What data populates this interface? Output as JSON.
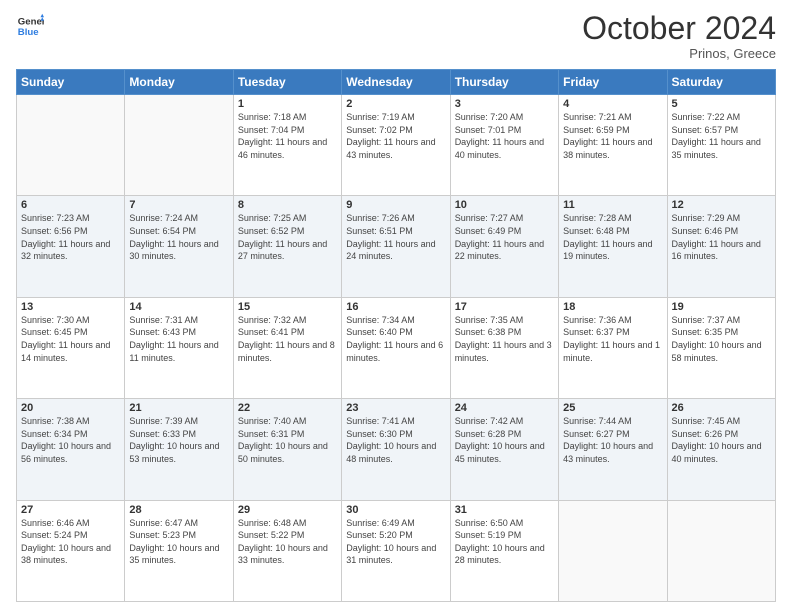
{
  "header": {
    "logo_general": "General",
    "logo_blue": "Blue",
    "month_title": "October 2024",
    "location": "Prinos, Greece"
  },
  "days_of_week": [
    "Sunday",
    "Monday",
    "Tuesday",
    "Wednesday",
    "Thursday",
    "Friday",
    "Saturday"
  ],
  "weeks": [
    [
      {
        "day": "",
        "info": ""
      },
      {
        "day": "",
        "info": ""
      },
      {
        "day": "1",
        "info": "Sunrise: 7:18 AM\nSunset: 7:04 PM\nDaylight: 11 hours and 46 minutes."
      },
      {
        "day": "2",
        "info": "Sunrise: 7:19 AM\nSunset: 7:02 PM\nDaylight: 11 hours and 43 minutes."
      },
      {
        "day": "3",
        "info": "Sunrise: 7:20 AM\nSunset: 7:01 PM\nDaylight: 11 hours and 40 minutes."
      },
      {
        "day": "4",
        "info": "Sunrise: 7:21 AM\nSunset: 6:59 PM\nDaylight: 11 hours and 38 minutes."
      },
      {
        "day": "5",
        "info": "Sunrise: 7:22 AM\nSunset: 6:57 PM\nDaylight: 11 hours and 35 minutes."
      }
    ],
    [
      {
        "day": "6",
        "info": "Sunrise: 7:23 AM\nSunset: 6:56 PM\nDaylight: 11 hours and 32 minutes."
      },
      {
        "day": "7",
        "info": "Sunrise: 7:24 AM\nSunset: 6:54 PM\nDaylight: 11 hours and 30 minutes."
      },
      {
        "day": "8",
        "info": "Sunrise: 7:25 AM\nSunset: 6:52 PM\nDaylight: 11 hours and 27 minutes."
      },
      {
        "day": "9",
        "info": "Sunrise: 7:26 AM\nSunset: 6:51 PM\nDaylight: 11 hours and 24 minutes."
      },
      {
        "day": "10",
        "info": "Sunrise: 7:27 AM\nSunset: 6:49 PM\nDaylight: 11 hours and 22 minutes."
      },
      {
        "day": "11",
        "info": "Sunrise: 7:28 AM\nSunset: 6:48 PM\nDaylight: 11 hours and 19 minutes."
      },
      {
        "day": "12",
        "info": "Sunrise: 7:29 AM\nSunset: 6:46 PM\nDaylight: 11 hours and 16 minutes."
      }
    ],
    [
      {
        "day": "13",
        "info": "Sunrise: 7:30 AM\nSunset: 6:45 PM\nDaylight: 11 hours and 14 minutes."
      },
      {
        "day": "14",
        "info": "Sunrise: 7:31 AM\nSunset: 6:43 PM\nDaylight: 11 hours and 11 minutes."
      },
      {
        "day": "15",
        "info": "Sunrise: 7:32 AM\nSunset: 6:41 PM\nDaylight: 11 hours and 8 minutes."
      },
      {
        "day": "16",
        "info": "Sunrise: 7:34 AM\nSunset: 6:40 PM\nDaylight: 11 hours and 6 minutes."
      },
      {
        "day": "17",
        "info": "Sunrise: 7:35 AM\nSunset: 6:38 PM\nDaylight: 11 hours and 3 minutes."
      },
      {
        "day": "18",
        "info": "Sunrise: 7:36 AM\nSunset: 6:37 PM\nDaylight: 11 hours and 1 minute."
      },
      {
        "day": "19",
        "info": "Sunrise: 7:37 AM\nSunset: 6:35 PM\nDaylight: 10 hours and 58 minutes."
      }
    ],
    [
      {
        "day": "20",
        "info": "Sunrise: 7:38 AM\nSunset: 6:34 PM\nDaylight: 10 hours and 56 minutes."
      },
      {
        "day": "21",
        "info": "Sunrise: 7:39 AM\nSunset: 6:33 PM\nDaylight: 10 hours and 53 minutes."
      },
      {
        "day": "22",
        "info": "Sunrise: 7:40 AM\nSunset: 6:31 PM\nDaylight: 10 hours and 50 minutes."
      },
      {
        "day": "23",
        "info": "Sunrise: 7:41 AM\nSunset: 6:30 PM\nDaylight: 10 hours and 48 minutes."
      },
      {
        "day": "24",
        "info": "Sunrise: 7:42 AM\nSunset: 6:28 PM\nDaylight: 10 hours and 45 minutes."
      },
      {
        "day": "25",
        "info": "Sunrise: 7:44 AM\nSunset: 6:27 PM\nDaylight: 10 hours and 43 minutes."
      },
      {
        "day": "26",
        "info": "Sunrise: 7:45 AM\nSunset: 6:26 PM\nDaylight: 10 hours and 40 minutes."
      }
    ],
    [
      {
        "day": "27",
        "info": "Sunrise: 6:46 AM\nSunset: 5:24 PM\nDaylight: 10 hours and 38 minutes."
      },
      {
        "day": "28",
        "info": "Sunrise: 6:47 AM\nSunset: 5:23 PM\nDaylight: 10 hours and 35 minutes."
      },
      {
        "day": "29",
        "info": "Sunrise: 6:48 AM\nSunset: 5:22 PM\nDaylight: 10 hours and 33 minutes."
      },
      {
        "day": "30",
        "info": "Sunrise: 6:49 AM\nSunset: 5:20 PM\nDaylight: 10 hours and 31 minutes."
      },
      {
        "day": "31",
        "info": "Sunrise: 6:50 AM\nSunset: 5:19 PM\nDaylight: 10 hours and 28 minutes."
      },
      {
        "day": "",
        "info": ""
      },
      {
        "day": "",
        "info": ""
      }
    ]
  ]
}
